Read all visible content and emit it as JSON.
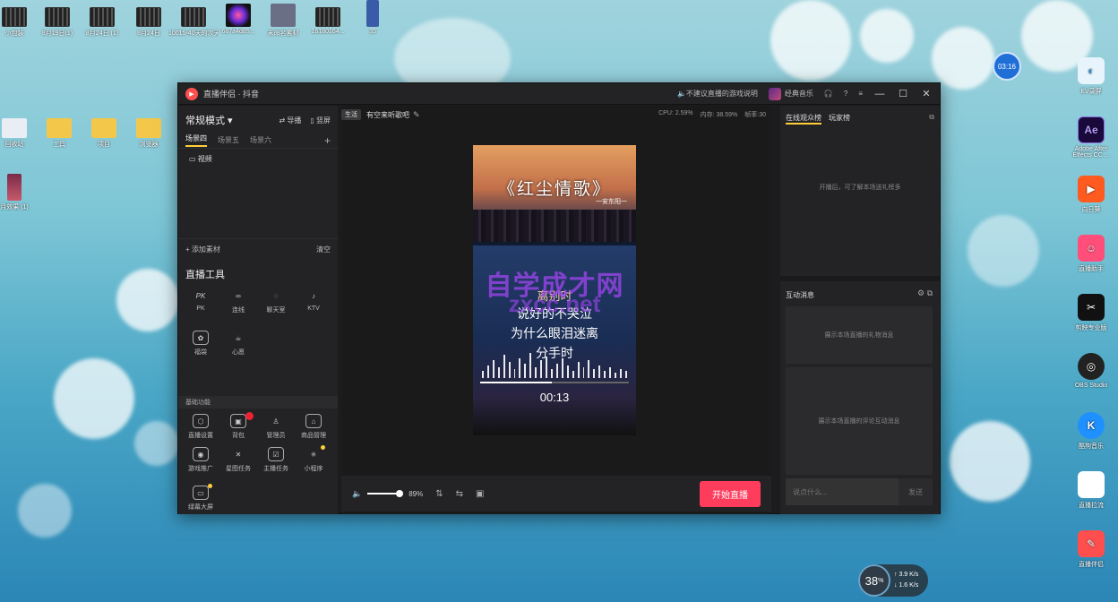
{
  "desktop_left_icons": [
    {
      "label": "小包装"
    },
    {
      "label": "8月19日(1)"
    },
    {
      "label": "8月24日 (1)"
    },
    {
      "label": "8月24日"
    },
    {
      "label": "10015-40天的次天4k..."
    },
    {
      "label": "687a4d85..."
    },
    {
      "label": "未命名素材"
    },
    {
      "label": "16180164..."
    },
    {
      "label": "35"
    }
  ],
  "desktop_left_col": [
    {
      "label": "回收站"
    },
    {
      "label": "工具"
    },
    {
      "label": "项目"
    },
    {
      "label": "浏览器"
    },
    {
      "label": "月效果 (1)"
    }
  ],
  "clock_badge": "03:16",
  "right_dock": [
    {
      "label": "EV录屏"
    },
    {
      "label": "Adobe After Effects CC ..."
    },
    {
      "label": "向日葵"
    },
    {
      "label": "直播助手"
    },
    {
      "label": "剪映专业版"
    },
    {
      "label": "OBS Studio"
    },
    {
      "label": "酷狗音乐"
    },
    {
      "label": "直播拉流"
    },
    {
      "label": "直播伴侣"
    }
  ],
  "app": {
    "title": "直播伴侣 · 抖音",
    "notice": "不建议直播的游戏说明",
    "music_label": "经典音乐",
    "left": {
      "mode": "常规模式 ▾",
      "import": "导播",
      "portrait": "竖屏",
      "scenes": [
        "场景四",
        "场景五",
        "场景六"
      ],
      "source": "视频",
      "add_material": "添加素材",
      "clear": "清空",
      "tools_title": "直播工具",
      "tools": [
        {
          "label": "PK",
          "icon": "PK"
        },
        {
          "label": "连线",
          "icon": "∞"
        },
        {
          "label": "聊天室",
          "icon": "◌"
        },
        {
          "label": "KTV",
          "icon": "♪"
        },
        {
          "label": "福袋",
          "icon": "✿"
        },
        {
          "label": "心愿",
          "icon": "☕"
        }
      ],
      "basic_label": "基础功能",
      "basic_tools": [
        {
          "label": "直播设置",
          "icon": "⬡"
        },
        {
          "label": "背包",
          "icon": "▣"
        },
        {
          "label": "管理员",
          "icon": "♙"
        },
        {
          "label": "商品管理",
          "icon": "⌂"
        },
        {
          "label": "游戏推广",
          "icon": "◉"
        },
        {
          "label": "星图任务",
          "icon": "✕"
        },
        {
          "label": "主播任务",
          "icon": "☑"
        },
        {
          "label": "小程序",
          "icon": "✳"
        },
        {
          "label": "绿幕大屏",
          "icon": "▭"
        }
      ]
    },
    "center": {
      "live_tag": "生活",
      "room_title": "有空来听歌吧",
      "cpu": "CPU: 2.59%",
      "mem": "内存: 38.59%",
      "fps": "帧率:30",
      "song_title": "《红尘情歌》",
      "song_artist": "一安东阳一",
      "lyrics": [
        "离别时",
        "说好的不哭泣",
        "为什么眼泪迷离",
        "分手时"
      ],
      "time": "00:13",
      "watermark": "自学成才网",
      "watermark2": "zxcc.net",
      "volume": "89%",
      "volume_level": 0.89,
      "start_button": "开始直播"
    },
    "right": {
      "tab_online": "在线观众榜",
      "tab_players": "玩家榜",
      "online_empty": "开播后，可了解本场送礼榜多",
      "im_title": "互动消息",
      "gift_placeholder": "展示本场直播的礼物消息",
      "comment_placeholder": "展示本场直播的评论互动消息",
      "input_placeholder": "说点什么...",
      "send": "发送"
    }
  },
  "net_widget": {
    "percent": "38",
    "unit": "%",
    "up": "3.9",
    "down": "1.6",
    "rate_unit": "K/s"
  }
}
